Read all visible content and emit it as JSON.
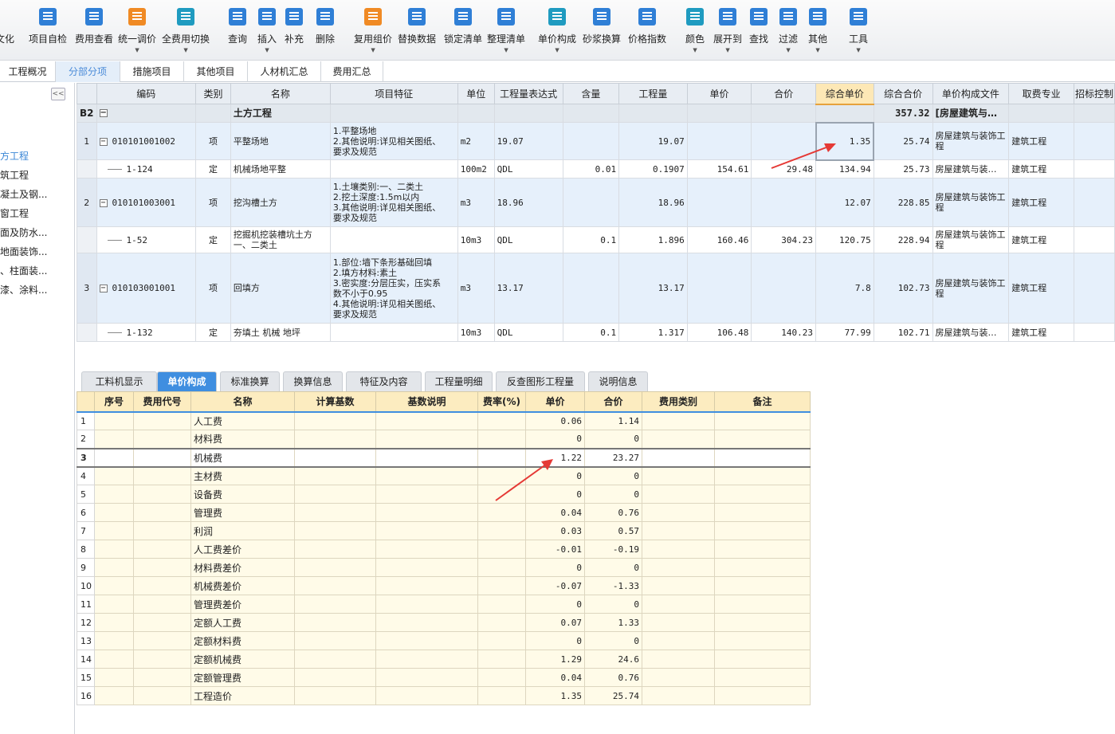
{
  "toolbar": {
    "items": [
      {
        "label": "文化",
        "icon": "partial-icon"
      },
      {
        "label": "项目自检",
        "icon": "check-list-icon"
      },
      {
        "label": "费用查看",
        "icon": "money-doc-icon"
      },
      {
        "label": "统一调价",
        "icon": "adjust-price-icon"
      },
      {
        "label": "全费用切换",
        "icon": "switch-icon"
      },
      {
        "label": "查询",
        "icon": "query-icon"
      },
      {
        "label": "插入",
        "icon": "insert-icon"
      },
      {
        "label": "补充",
        "icon": "supplement-icon"
      },
      {
        "label": "删除",
        "icon": "delete-icon"
      },
      {
        "label": "复用组价",
        "icon": "reuse-icon"
      },
      {
        "label": "替换数据",
        "icon": "replace-icon"
      },
      {
        "label": "锁定清单",
        "icon": "lock-icon"
      },
      {
        "label": "整理清单",
        "icon": "organize-icon"
      },
      {
        "label": "单价构成",
        "icon": "price-compose-icon"
      },
      {
        "label": "砂浆换算",
        "icon": "mortar-icon"
      },
      {
        "label": "价格指数",
        "icon": "price-index-icon"
      },
      {
        "label": "颜色",
        "icon": "color-icon"
      },
      {
        "label": "展开到",
        "icon": "expand-icon"
      },
      {
        "label": "查找",
        "icon": "binoculars-icon"
      },
      {
        "label": "过滤",
        "icon": "filter-icon"
      },
      {
        "label": "其他",
        "icon": "grid-icon"
      },
      {
        "label": "工具",
        "icon": "tools-icon"
      }
    ]
  },
  "tabs": [
    "工程概况",
    "分部分项",
    "措施项目",
    "其他项目",
    "人材机汇总",
    "费用汇总"
  ],
  "sidebar": {
    "items": [
      "方工程",
      "筑工程",
      "凝土及钢...",
      "窗工程",
      "面及防水...",
      "地面装饰...",
      "、柱面装...",
      "漆、涂料..."
    ]
  },
  "grid": {
    "headers": [
      "",
      "编码",
      "类别",
      "名称",
      "项目特征",
      "单位",
      "工程量表达式",
      "含量",
      "工程量",
      "单价",
      "合价",
      "综合单价",
      "综合合价",
      "单价构成文件",
      "取费专业",
      "招标控制"
    ],
    "group": {
      "rn": "B2",
      "name": "土方工程",
      "total": "357.32",
      "file": "[房屋建筑与…"
    },
    "rows": [
      {
        "rn": "1",
        "code": "010101001002",
        "type": "项",
        "name": "平整场地",
        "feature": [
          "1.平整场地",
          "2.其他说明:详见相关图纸、",
          "要求及规范"
        ],
        "unit": "m2",
        "expr": "19.07",
        "qty_ratio": "",
        "qty": "19.07",
        "price": "",
        "amount": "",
        "unit_price": "1.35",
        "total": "25.74",
        "file": "房屋建筑与装饰工程",
        "fee": "建筑工程",
        "item": true
      },
      {
        "rn": "",
        "code": "1-124",
        "type": "定",
        "name": "机械场地平整",
        "feature": [],
        "unit": "100m2",
        "expr": "QDL",
        "qty_ratio": "0.01",
        "qty": "0.1907",
        "price": "154.61",
        "amount": "29.48",
        "unit_price": "134.94",
        "total": "25.73",
        "file": "房屋建筑与装…",
        "fee": "建筑工程",
        "item": false
      },
      {
        "rn": "2",
        "code": "010101003001",
        "type": "项",
        "name": "挖沟槽土方",
        "feature": [
          "1.土壤类别:一、二类土",
          "2.挖土深度:1.5m以内",
          "3.其他说明:详见相关图纸、",
          "要求及规范"
        ],
        "unit": "m3",
        "expr": "18.96",
        "qty_ratio": "",
        "qty": "18.96",
        "price": "",
        "amount": "",
        "unit_price": "12.07",
        "total": "228.85",
        "file": "房屋建筑与装饰工程",
        "fee": "建筑工程",
        "item": true
      },
      {
        "rn": "",
        "code": "1-52",
        "type": "定",
        "name": "挖掘机挖装槽坑土方一、二类土",
        "feature": [],
        "unit": "10m3",
        "expr": "QDL",
        "qty_ratio": "0.1",
        "qty": "1.896",
        "price": "160.46",
        "amount": "304.23",
        "unit_price": "120.75",
        "total": "228.94",
        "file": "房屋建筑与装饰工程",
        "fee": "建筑工程",
        "item": false
      },
      {
        "rn": "3",
        "code": "010103001001",
        "type": "项",
        "name": "回填方",
        "feature": [
          "1.部位:墙下条形基础回填",
          "2.填方材料:素土",
          "3.密实度:分层压实，压实系",
          "数不小于0.95",
          "4.其他说明:详见相关图纸、",
          "要求及规范"
        ],
        "unit": "m3",
        "expr": "13.17",
        "qty_ratio": "",
        "qty": "13.17",
        "price": "",
        "amount": "",
        "unit_price": "7.8",
        "total": "102.73",
        "file": "房屋建筑与装饰工程",
        "fee": "建筑工程",
        "item": true
      },
      {
        "rn": "",
        "code": "1-132",
        "type": "定",
        "name": "夯填土 机械 地坪",
        "feature": [],
        "unit": "10m3",
        "expr": "QDL",
        "qty_ratio": "0.1",
        "qty": "1.317",
        "price": "106.48",
        "amount": "140.23",
        "unit_price": "77.99",
        "total": "102.71",
        "file": "房屋建筑与装…",
        "fee": "建筑工程",
        "item": false
      }
    ]
  },
  "bottom_tabs": [
    "工料机显示",
    "单价构成",
    "标准换算",
    "换算信息",
    "特征及内容",
    "工程量明细",
    "反查图形工程量",
    "说明信息"
  ],
  "detail": {
    "headers": [
      "",
      "序号",
      "费用代号",
      "名称",
      "计算基数",
      "基数说明",
      "费率(%)",
      "单价",
      "合价",
      "费用类别",
      "备注"
    ],
    "rows": [
      {
        "rn": "1",
        "name": "人工费",
        "price": "0.06",
        "amount": "1.14"
      },
      {
        "rn": "2",
        "name": "材料费",
        "price": "0",
        "amount": "0"
      },
      {
        "rn": "3",
        "name": "机械费",
        "price": "1.22",
        "amount": "23.27"
      },
      {
        "rn": "4",
        "name": "主材费",
        "price": "0",
        "amount": "0"
      },
      {
        "rn": "5",
        "name": "设备费",
        "price": "0",
        "amount": "0"
      },
      {
        "rn": "6",
        "name": "管理费",
        "price": "0.04",
        "amount": "0.76"
      },
      {
        "rn": "7",
        "name": "利润",
        "price": "0.03",
        "amount": "0.57"
      },
      {
        "rn": "8",
        "name": "人工费差价",
        "price": "-0.01",
        "amount": "-0.19"
      },
      {
        "rn": "9",
        "name": "材料费差价",
        "price": "0",
        "amount": "0"
      },
      {
        "rn": "10",
        "name": "机械费差价",
        "price": "-0.07",
        "amount": "-1.33"
      },
      {
        "rn": "11",
        "name": "管理费差价",
        "price": "0",
        "amount": "0"
      },
      {
        "rn": "12",
        "name": "定额人工费",
        "price": "0.07",
        "amount": "1.33"
      },
      {
        "rn": "13",
        "name": "定额材料费",
        "price": "0",
        "amount": "0"
      },
      {
        "rn": "14",
        "name": "定额机械费",
        "price": "1.29",
        "amount": "24.6"
      },
      {
        "rn": "15",
        "name": "定额管理费",
        "price": "0.04",
        "amount": "0.76"
      },
      {
        "rn": "16",
        "name": "工程造价",
        "price": "1.35",
        "amount": "25.74"
      }
    ]
  },
  "colors": {
    "accent": "#3f8ee0",
    "highlight_header": "#fde8b6",
    "annotation_arrow": "#e53935"
  }
}
